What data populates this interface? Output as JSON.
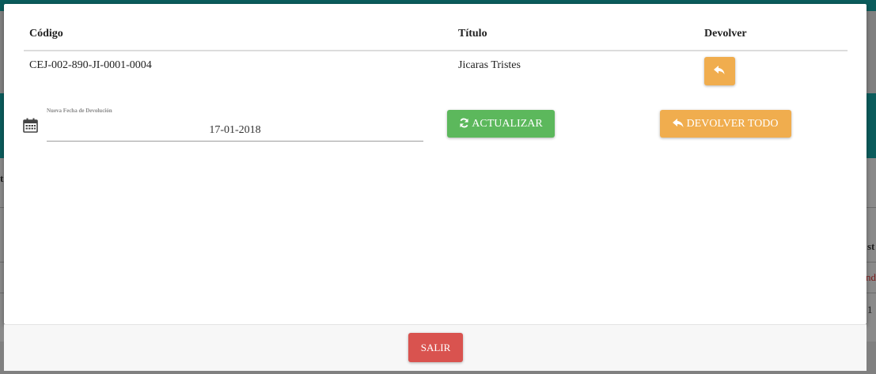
{
  "background": {
    "fragment_1": "t",
    "fragment_2": "st",
    "fragment_3": "nd",
    "fragment_4": "1"
  },
  "modal": {
    "table": {
      "headers": [
        "Código",
        "Título",
        "Devolver"
      ],
      "rows": [
        {
          "codigo": "CEJ-002-890-JI-0001-0004",
          "titulo": "Jicaras Tristes",
          "action_icon": "reply-icon"
        }
      ]
    },
    "date_field": {
      "label": "Nueva Fecha de Devolución",
      "value": "17-01-2018",
      "icon": "calendar-icon"
    },
    "buttons": {
      "update_label": "ACTUALIZAR",
      "update_icon": "refresh-icon",
      "return_all_label": "DEVOLVER TODO",
      "return_all_icon": "reply-icon"
    }
  },
  "footer": {
    "exit_label": "SALIR"
  },
  "colors": {
    "success": "#5cb85c",
    "warning": "#f0ad4e",
    "danger": "#d9534f",
    "header_teal": "#0b5c5c"
  }
}
